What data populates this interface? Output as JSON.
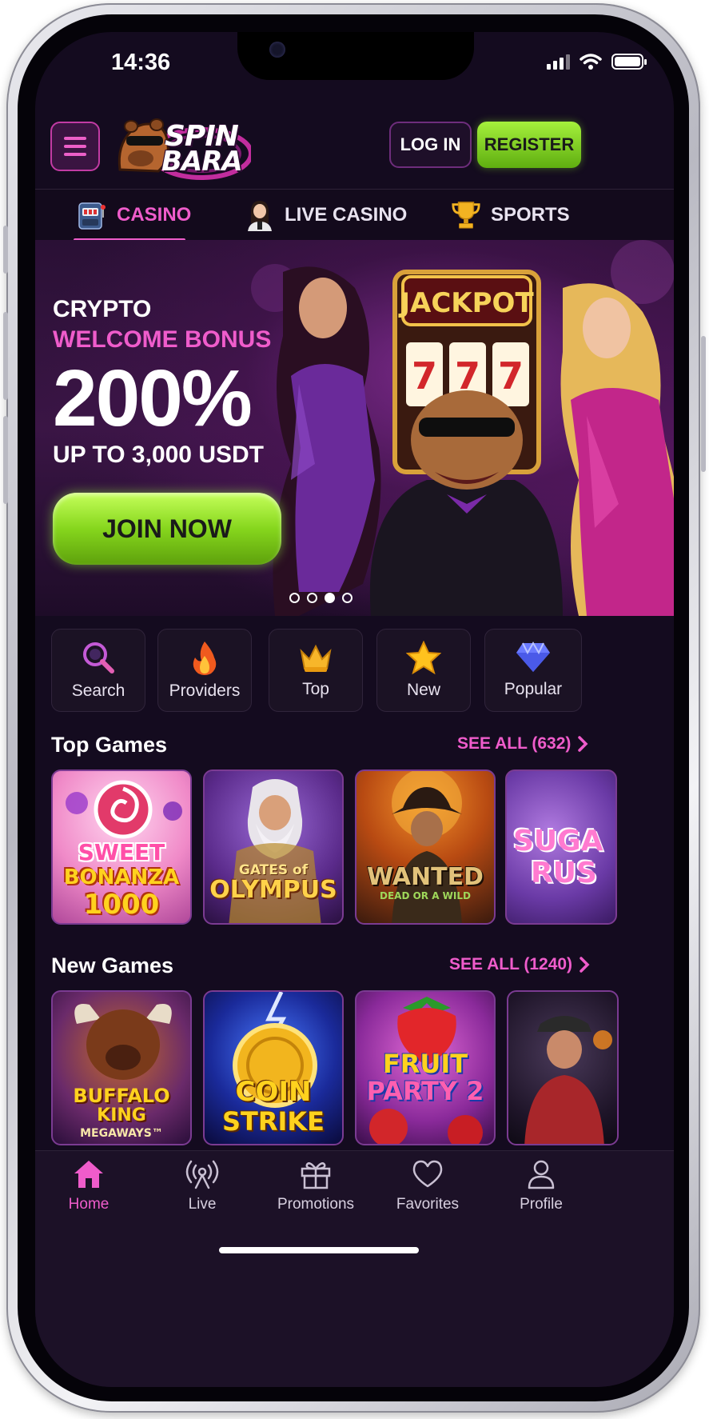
{
  "status_bar": {
    "time": "14:36"
  },
  "header": {
    "logo_line1": "SPIN",
    "logo_line2": "BARA",
    "login_label": "LOG IN",
    "register_label": "REGISTER"
  },
  "tabs": [
    {
      "label": "CASINO",
      "icon": "slot-machine-icon",
      "active": true
    },
    {
      "label": "LIVE CASINO",
      "icon": "dealer-icon",
      "active": false
    },
    {
      "label": "SPORTS",
      "icon": "trophy-icon",
      "active": false
    }
  ],
  "banner": {
    "line1": "CRYPTO",
    "line2": "WELCOME BONUS",
    "big": "200%",
    "sub": "UP TO 3,000 USDT",
    "cta": "JOIN NOW",
    "art_label": "JACKPOT",
    "reel_digits": [
      "7",
      "7",
      "7"
    ],
    "slides_total": 4,
    "active_slide": 3
  },
  "filters": [
    {
      "label": "Search",
      "icon": "search-icon"
    },
    {
      "label": "Providers",
      "icon": "fire-icon"
    },
    {
      "label": "Top",
      "icon": "crown-icon"
    },
    {
      "label": "New",
      "icon": "star-icon"
    },
    {
      "label": "Popular",
      "icon": "diamond-icon"
    }
  ],
  "top_games": {
    "title": "Top Games",
    "see_all": "SEE ALL (632)",
    "games": [
      {
        "line1": "SWEET",
        "line2": "BONANZA",
        "line3": "1000"
      },
      {
        "line1": "GATES of",
        "line2": "OLYMPUS",
        "line3": ""
      },
      {
        "line1": "WANTED",
        "line2": "DEAD OR A WILD",
        "line3": ""
      },
      {
        "line1": "SUGA",
        "line2": "RUS",
        "line3": ""
      }
    ]
  },
  "new_games": {
    "title": "New Games",
    "see_all": "SEE ALL (1240)",
    "games": [
      {
        "line1": "BUFFALO",
        "line2": "KING",
        "line3": "MEGAWAYS™"
      },
      {
        "line1": "COIN",
        "line2": "STRIKE",
        "line3": ""
      },
      {
        "line1": "FRUIT",
        "line2": "PARTY 2",
        "line3": ""
      },
      {
        "line1": "",
        "line2": "",
        "line3": ""
      }
    ]
  },
  "bottom_nav": [
    {
      "label": "Home",
      "icon": "home-icon",
      "active": true
    },
    {
      "label": "Live",
      "icon": "broadcast-icon",
      "active": false
    },
    {
      "label": "Promotions",
      "icon": "gift-icon",
      "active": false
    },
    {
      "label": "Favorites",
      "icon": "heart-icon",
      "active": false
    },
    {
      "label": "Profile",
      "icon": "user-icon",
      "active": false
    }
  ],
  "colors": {
    "accent_pink": "#ef5ccb",
    "accent_green": "#8ed62a",
    "background": "#140b1f"
  }
}
